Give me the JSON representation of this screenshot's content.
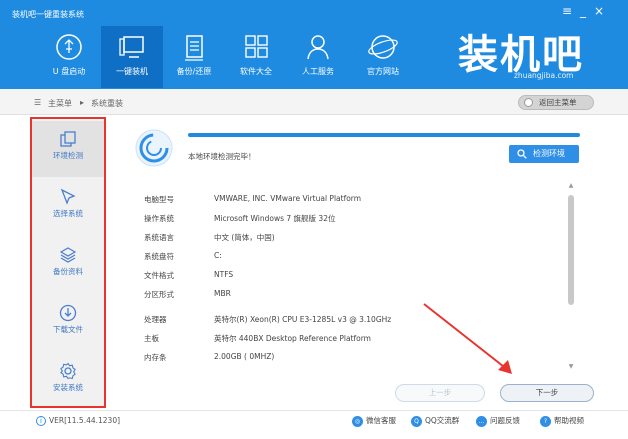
{
  "window": {
    "title": "装机吧一键重装系统"
  },
  "window_controls": {
    "menu": "≡",
    "minimize": "_",
    "close": "×"
  },
  "nav": [
    {
      "label": "U 盘启动",
      "icon": "usb-icon"
    },
    {
      "label": "一键装机",
      "icon": "monitor-icon"
    },
    {
      "label": "备份/还原",
      "icon": "document-icon"
    },
    {
      "label": "软件大全",
      "icon": "grid-icon"
    },
    {
      "label": "人工服务",
      "icon": "person-icon"
    },
    {
      "label": "官方网站",
      "icon": "globe-icon"
    }
  ],
  "logo": {
    "text": "装机吧",
    "url": "zhuangjiba.com"
  },
  "breadcrumb": {
    "root": "主菜单",
    "separator": "▸",
    "current": "系统重装",
    "back_button": "返回主菜单"
  },
  "sidebar": [
    {
      "label": "环境检测",
      "icon": "environment-check-icon",
      "active": true
    },
    {
      "label": "选择系统",
      "icon": "cursor-icon",
      "active": false
    },
    {
      "label": "备份资料",
      "icon": "layers-icon",
      "active": false
    },
    {
      "label": "下载文件",
      "icon": "download-icon",
      "active": false
    },
    {
      "label": "安装系统",
      "icon": "gear-icon",
      "active": false
    }
  ],
  "check": {
    "status": "本地环境检测完毕！",
    "button": "检测环境",
    "progress": 1.0
  },
  "info": [
    {
      "key": "电脑型号",
      "value": "VMWARE, INC. VMware Virtual Platform"
    },
    {
      "key": "操作系统",
      "value": "Microsoft Windows 7 旗舰版  32位"
    },
    {
      "key": "系统语言",
      "value": "中文 (简体，中国)"
    },
    {
      "key": "系统盘符",
      "value": "C:"
    },
    {
      "key": "文件格式",
      "value": "NTFS"
    },
    {
      "key": "分区形式",
      "value": "MBR"
    },
    {
      "key": "处理器",
      "value": "英特尔(R) Xeon(R) CPU E3-1285L v3 @ 3.10GHz"
    },
    {
      "key": "主板",
      "value": "英特尔 440BX Desktop Reference Platform"
    },
    {
      "key": "内存条",
      "value": "2.00GB ( 0MHZ)"
    }
  ],
  "buttons": {
    "prev": "上一步",
    "next": "下一步"
  },
  "footer": {
    "version": "VER[11.5.44.1230]",
    "links": [
      {
        "label": "微信客服",
        "icon": "wechat-icon"
      },
      {
        "label": "QQ交流群",
        "icon": "qq-icon"
      },
      {
        "label": "问题反馈",
        "icon": "feedback-icon"
      },
      {
        "label": "帮助视频",
        "icon": "help-icon"
      }
    ]
  },
  "colors": {
    "header": "#1e8be0",
    "accent": "#2f8ee5",
    "annotation": "#e8342e"
  }
}
